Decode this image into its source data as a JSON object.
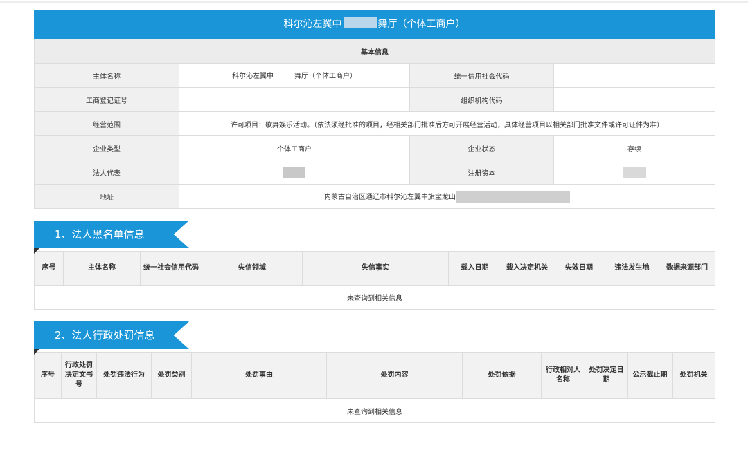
{
  "header": {
    "title_left": "科尔沁左翼中",
    "title_right": "舞厅（个体工商户）"
  },
  "basic": {
    "section_title": "基本信息",
    "fields": {
      "subject_name_label": "主体名称",
      "subject_name_left": "科尔沁左翼中",
      "subject_name_right": "舞厅（个体工商户）",
      "credit_code_label": "统一信用社会代码",
      "reg_no_label": "工商登记证号",
      "org_code_label": "组织机构代码",
      "scope_label": "经营范围",
      "scope_value": "许可项目：歌舞娱乐活动。（依法须经批准的项目，经相关部门批准后方可开展经营活动，具体经营项目以相关部门批准文件或许可证件为准）",
      "type_label": "企业类型",
      "type_value": "个体工商户",
      "status_label": "企业状态",
      "status_value": "存续",
      "legal_rep_label": "法人代表",
      "capital_label": "注册资本",
      "address_label": "地址",
      "address_value": "内蒙古自治区通辽市科尔沁左翼中旗宝龙山"
    }
  },
  "blacklist": {
    "title": "1、法人黑名单信息",
    "columns": [
      "序号",
      "主体名称",
      "统一社会信用代码",
      "失信领域",
      "失信事实",
      "载入日期",
      "载入决定机关",
      "失效日期",
      "违法发生地",
      "数据来源部门"
    ],
    "empty_text": "未查询到相关信息"
  },
  "penalty": {
    "title": "2、法人行政处罚信息",
    "columns": [
      "序号",
      "行政处罚决定文书号",
      "处罚违法行为",
      "处罚类别",
      "处罚事由",
      "处罚内容",
      "处罚依据",
      "行政相对人名称",
      "处罚决定日期",
      "公示截止期",
      "处罚机关"
    ],
    "empty_text": "未查询到相关信息"
  },
  "colors": {
    "accent": "#1a95d8",
    "label_bg": "#f0f0f0",
    "border": "#dcdcdc"
  }
}
